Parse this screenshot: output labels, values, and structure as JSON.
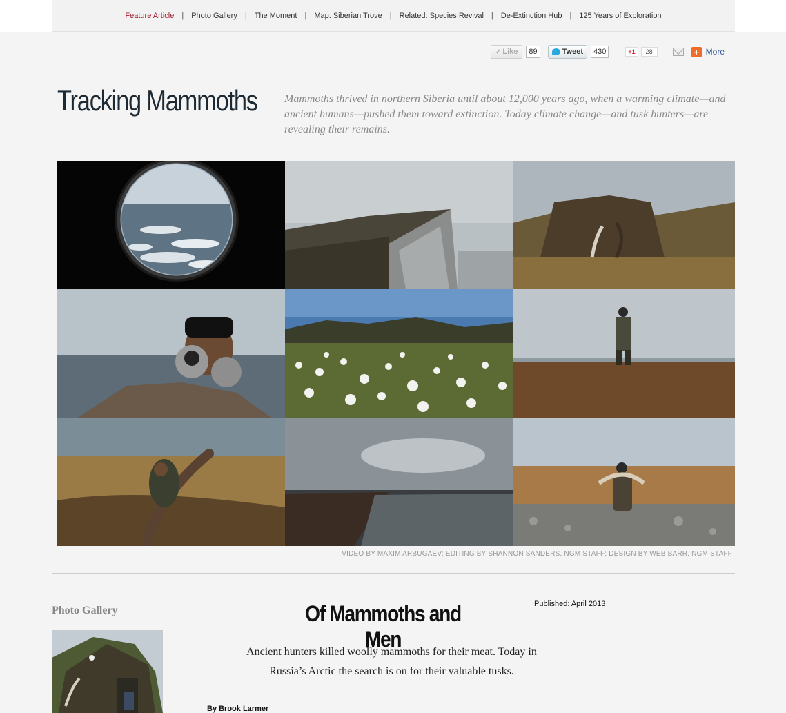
{
  "nav": {
    "items": [
      {
        "label": "Feature Article",
        "active": true
      },
      {
        "label": "Photo Gallery",
        "active": false
      },
      {
        "label": "The Moment",
        "active": false
      },
      {
        "label": "Map: Siberian Trove",
        "active": false
      },
      {
        "label": "Related: Species Revival",
        "active": false
      },
      {
        "label": "De-Extinction Hub",
        "active": false
      },
      {
        "label": "125 Years of Exploration",
        "active": false
      }
    ],
    "separator": "|",
    "active_color": "#a3192b"
  },
  "social": {
    "like_label": "Like",
    "like_count": "89",
    "tweet_label": "Tweet",
    "tweet_count": "430",
    "gplus_label": "+1",
    "gplus_count": "28",
    "more_label": "More",
    "plus_glyph": "+",
    "check_glyph": "✓"
  },
  "header": {
    "title": "Tracking Mammoths",
    "dek": "Mammoths thrived in northern Siberia until about 12,000 years ago, when a warming climate—and ancient humans—pushed them toward extinction. Today climate change—and tusk hunters—are revealing their remains."
  },
  "video": {
    "credit": "VIDEO BY MAXIM ARBUGAEV; EDITING BY SHANNON SANDERS, NGM STAFF; DESIGN BY WEB BARR, NGM STAFF",
    "tiles": [
      {
        "name": "porthole-sea-ice-photo"
      },
      {
        "name": "foggy-cliff-photo"
      },
      {
        "name": "sod-hut-with-tusks-photo"
      },
      {
        "name": "man-with-binoculars-photo"
      },
      {
        "name": "cotton-grass-field-photo"
      },
      {
        "name": "walking-hunter-photo"
      },
      {
        "name": "man-holding-tusk-photo"
      },
      {
        "name": "stormy-shoreline-photo"
      },
      {
        "name": "man-carrying-tusk-photo"
      }
    ]
  },
  "gallery": {
    "label": "Photo Gallery"
  },
  "article": {
    "title": "Of Mammoths and Men",
    "published": "Published: April 2013",
    "dek": "Ancient hunters killed woolly mammoths for their meat. Today in Russia’s Arctic the search is on for their valuable tusks.",
    "byline": "By Brook Larmer"
  }
}
